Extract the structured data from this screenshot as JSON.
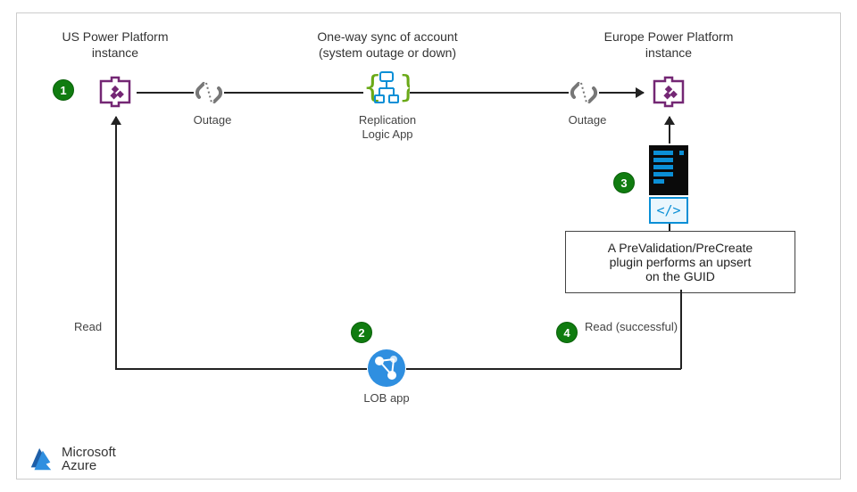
{
  "nodes": {
    "us_pp": {
      "title": "US Power Platform\ninstance"
    },
    "outage_left": {
      "label": "Outage"
    },
    "sync": {
      "title": "One-way sync of account\n(system outage or down)",
      "sub": "Replication\nLogic App"
    },
    "outage_right": {
      "label": "Outage"
    },
    "eu_pp": {
      "title": "Europe Power Platform\ninstance"
    },
    "plugin_box": {
      "text": "A PreValidation/PreCreate\nplugin performs an upsert\non the GUID"
    },
    "lob": {
      "label": "LOB app"
    }
  },
  "edges": {
    "read_left": "Read",
    "read_right": "Read (successful)"
  },
  "badges": {
    "b1": "1",
    "b2": "2",
    "b3": "3",
    "b4": "4"
  },
  "brand": {
    "name": "Microsoft",
    "product": "Azure"
  },
  "code_glyph": "</>",
  "chart_data": {
    "type": "diagram",
    "title": "Power Platform cross-region replication with outage and upsert plugin",
    "nodes": [
      {
        "id": "us_pp",
        "label": "US Power Platform instance",
        "badge": 1
      },
      {
        "id": "outage_left",
        "label": "Outage (broken link)"
      },
      {
        "id": "logic_app",
        "label": "Replication Logic App — One-way sync of account (system outage or down)"
      },
      {
        "id": "outage_right",
        "label": "Outage (broken link)"
      },
      {
        "id": "eu_pp",
        "label": "Europe Power Platform instance"
      },
      {
        "id": "plugin",
        "label": "Server + code component",
        "badge": 3
      },
      {
        "id": "plugin_box",
        "label": "A PreValidation/PreCreate plugin performs an upsert on the GUID"
      },
      {
        "id": "lob",
        "label": "LOB app",
        "badge": 2
      }
    ],
    "edges": [
      {
        "from": "us_pp",
        "to": "outage_left",
        "style": "line"
      },
      {
        "from": "outage_left",
        "to": "logic_app",
        "style": "line"
      },
      {
        "from": "logic_app",
        "to": "outage_right",
        "style": "line"
      },
      {
        "from": "outage_right",
        "to": "eu_pp",
        "style": "arrow"
      },
      {
        "from": "plugin",
        "to": "eu_pp",
        "style": "arrow"
      },
      {
        "from": "plugin_box",
        "to": "plugin",
        "style": "attach"
      },
      {
        "from": "lob",
        "to": "us_pp",
        "label": "Read",
        "style": "arrow"
      },
      {
        "from": "lob",
        "to": "plugin_box",
        "label": "Read (successful)",
        "badge": 4,
        "style": "line"
      }
    ]
  }
}
